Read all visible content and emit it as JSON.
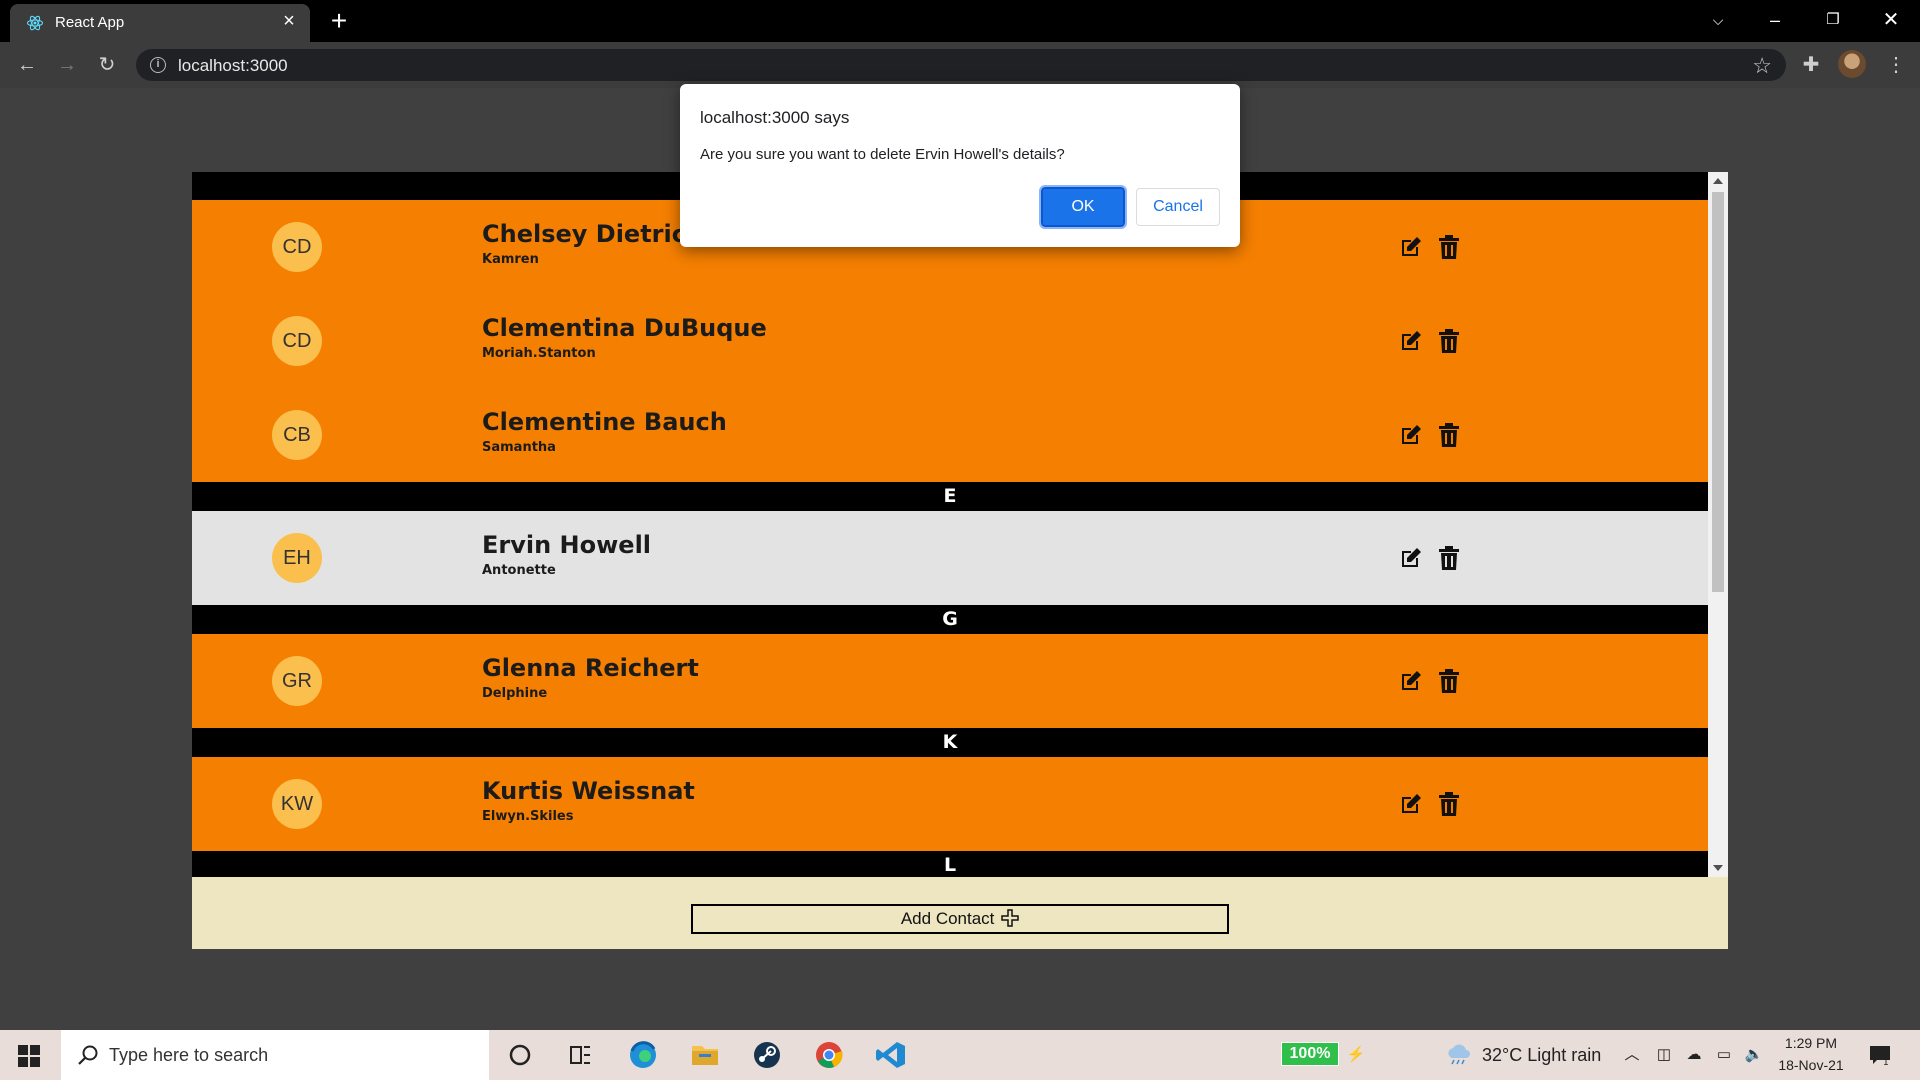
{
  "browser": {
    "tab_title": "React App",
    "url": "localhost:3000"
  },
  "dialog": {
    "title": "localhost:3000 says",
    "message": "Are you sure you want to delete Ervin Howell's details?",
    "ok_label": "OK",
    "cancel_label": "Cancel"
  },
  "contacts": {
    "rows": [
      {
        "initials": "CD",
        "name": "Chelsey Dietrich",
        "username": "Kamren"
      },
      {
        "initials": "CD",
        "name": "Clementina DuBuque",
        "username": "Moriah.Stanton"
      },
      {
        "initials": "CB",
        "name": "Clementine Bauch",
        "username": "Samantha"
      },
      {
        "initials": "EH",
        "name": "Ervin Howell",
        "username": "Antonette"
      },
      {
        "initials": "GR",
        "name": "Glenna Reichert",
        "username": "Delphine"
      },
      {
        "initials": "KW",
        "name": "Kurtis Weissnat",
        "username": "Elwyn.Skiles"
      }
    ],
    "section_letters": [
      "E",
      "G",
      "K",
      "L"
    ],
    "highlighted_contact": "Ervin Howell"
  },
  "footer": {
    "add_label": "Add Contact"
  },
  "taskbar": {
    "search_placeholder": "Type here to search",
    "battery": "100%",
    "weather": "32°C  Light rain",
    "time": "1:29 PM",
    "date": "18-Nov-21",
    "notification_count": "1"
  },
  "colors": {
    "row_bg": "#f57f00",
    "row_highlight_bg": "#e3e3e3",
    "avatar_bg": "#fbbf4e",
    "footer_bg": "#ede6c1",
    "section_header_bg": "#000000",
    "page_bg": "#404040",
    "dialog_ok": "#1a73e8"
  }
}
